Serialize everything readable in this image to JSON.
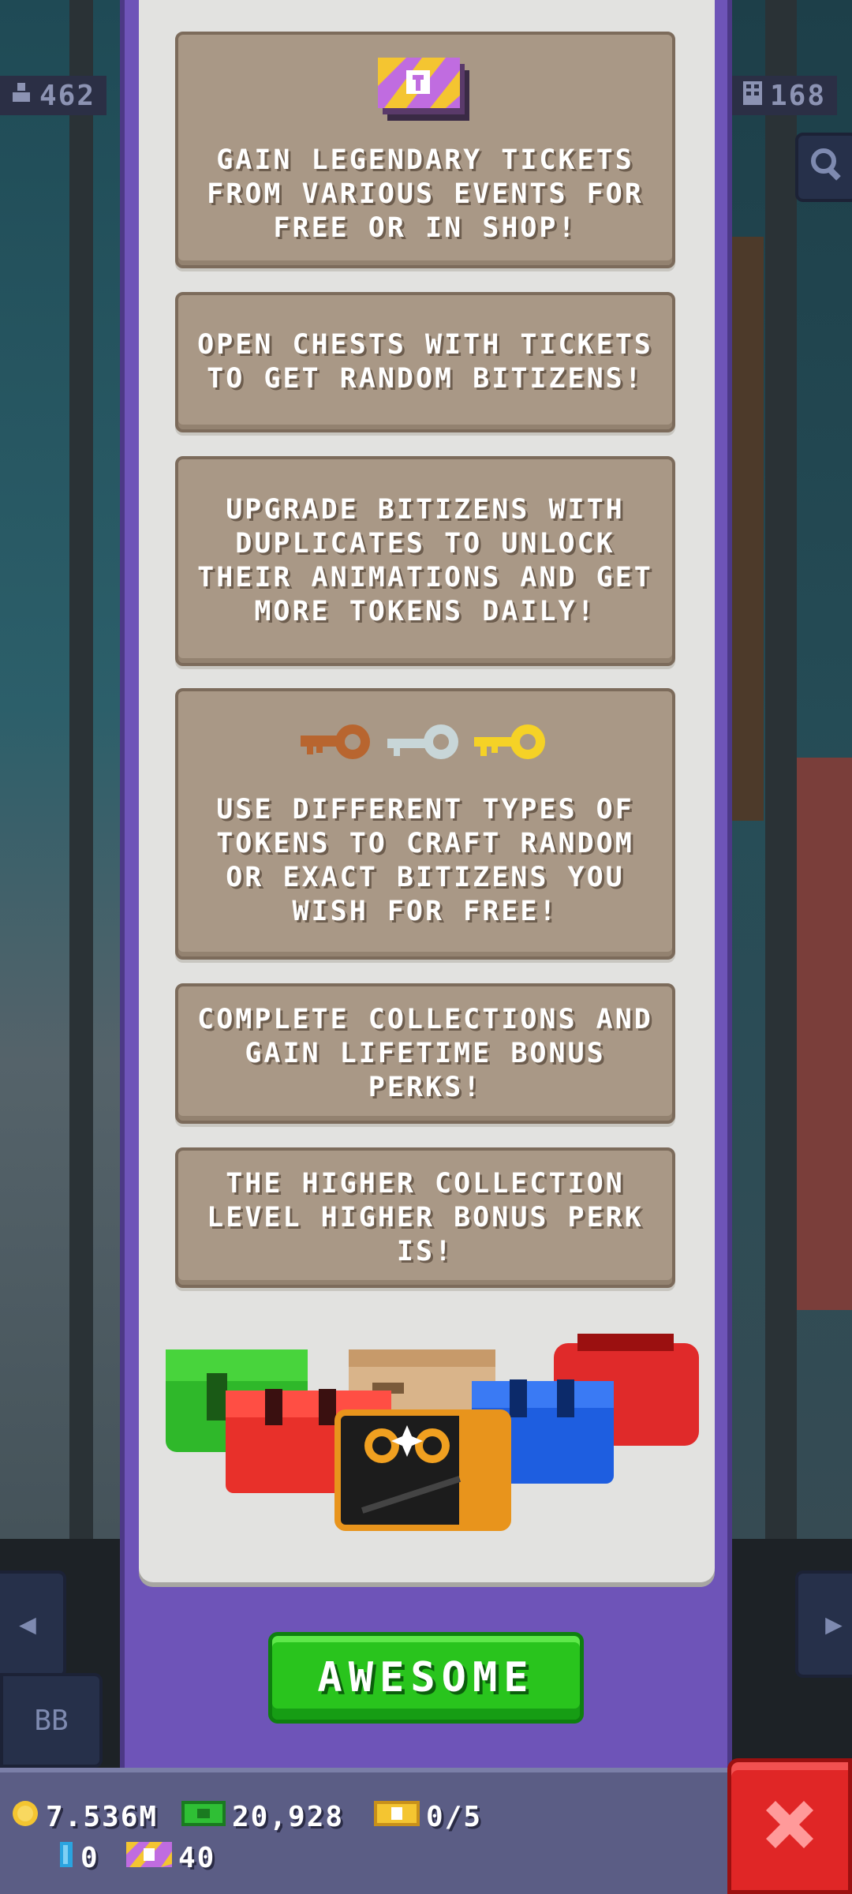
{
  "hud": {
    "left_stat": "462",
    "right_stat": "168",
    "bb_label": "BB"
  },
  "tips": [
    {
      "text": "GAIN LEGENDARY TICKETS FROM VARIOUS EVENTS FOR FREE OR IN SHOP!"
    },
    {
      "text": "OPEN CHESTS WITH TICKETS TO GET RANDOM BITIZENS!"
    },
    {
      "text": "UPGRADE BITIZENS WITH DUPLICATES TO UNLOCK THEIR ANIMATIONS AND GET MORE TOKENS DAILY!"
    },
    {
      "text": "USE DIFFERENT TYPES OF TOKENS TO CRAFT RANDOM OR EXACT BITIZENS YOU WISH FOR FREE!"
    },
    {
      "text": "COMPLETE COLLECTIONS AND GAIN LIFETIME BONUS PERKS!"
    },
    {
      "text": "THE HIGHER COLLECTION LEVEL HIGHER BONUS PERK IS!"
    }
  ],
  "button": {
    "label": "AWESOME"
  },
  "resources": {
    "coins": "7.536M",
    "bux": "20,928",
    "golden_tickets": "0/5",
    "blue": "0",
    "legendary_tickets": "40"
  },
  "colors": {
    "panel_purple": "#6e54b8",
    "tip_bg": "#a99886",
    "button_green": "#29c41d",
    "close_red": "#e02626"
  },
  "icons": [
    "ticket-stack-icon",
    "bronze-key-icon",
    "silver-key-icon",
    "gold-key-icon",
    "chests-illustration",
    "coin-icon",
    "bux-icon",
    "golden-ticket-icon",
    "blue-gem-icon",
    "legendary-ticket-icon",
    "close-icon"
  ]
}
